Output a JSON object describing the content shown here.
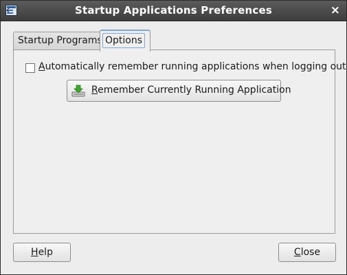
{
  "window": {
    "title": "Startup Applications Preferences",
    "icon": "startup-app-icon",
    "close_glyph": "×"
  },
  "tabs": [
    {
      "label": "Startup Programs",
      "selected": false
    },
    {
      "label": "Options",
      "selected": true
    }
  ],
  "options": {
    "auto_remember": {
      "mnemonic": "A",
      "label_rest": "utomatically remember running applications when logging out",
      "checked": false
    },
    "remember_button": {
      "mnemonic": "R",
      "label_rest": "emember Currently Running Application",
      "icon": "download-save-icon"
    }
  },
  "footer": {
    "help": {
      "mnemonic": "H",
      "label_rest": "elp"
    },
    "close": {
      "mnemonic": "C",
      "label_rest": "lose"
    }
  },
  "colors": {
    "titlebar": "#4a4a4a",
    "window_bg": "#ededed",
    "focus_accent": "#7ea6cf",
    "icon_green": "#3fa82a"
  }
}
